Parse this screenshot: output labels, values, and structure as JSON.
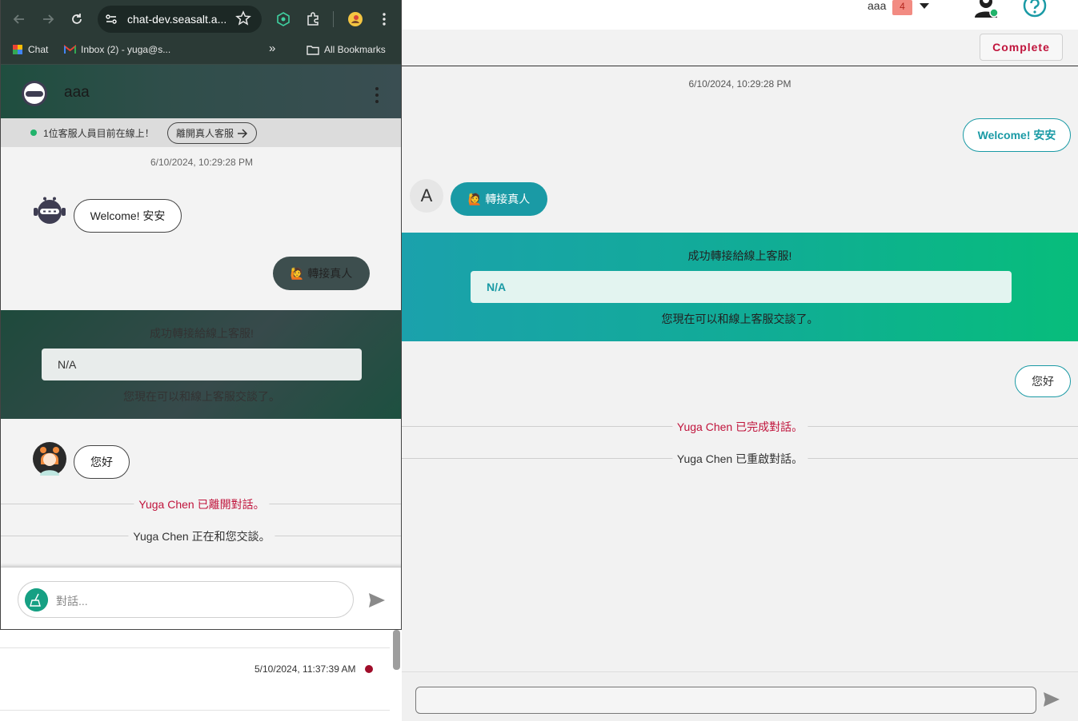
{
  "browser": {
    "url": "chat-dev.seasalt.a...",
    "bookmarks": [
      "Chat",
      "Inbox (2) - yuga@s..."
    ],
    "all_bookmarks": "All Bookmarks",
    "overflow": "»"
  },
  "widget": {
    "title": "aaa",
    "online_status": "1位客服人員目前在線上！",
    "leave_button": "離開真人客服",
    "timestamp": "6/10/2024, 10:29:28 PM",
    "welcome_message": "Welcome! 安安",
    "transfer_message": "轉接真人",
    "transfer_emoji": "🙋",
    "banner": {
      "title": "成功轉接給線上客服!",
      "box": "N/A",
      "subtitle": "您現在可以和線上客服交談了。"
    },
    "agent_message": "您好",
    "system_left": "Yuga Chen 已離開對話。",
    "system_talking": "Yuga Chen 正在和您交談。",
    "input_placeholder": "對話..."
  },
  "background_list": {
    "timestamp": "5/10/2024, 11:37:39 AM"
  },
  "console": {
    "user_name": "aaa",
    "count_badge": "4",
    "complete_button": "Complete",
    "timestamp": "6/10/2024, 10:29:28 PM",
    "welcome_message": "Welcome! 安安",
    "customer_initial": "A",
    "transfer_message": "轉接真人",
    "transfer_emoji": "🙋",
    "banner": {
      "title": "成功轉接給線上客服!",
      "box": "N/A",
      "subtitle": "您現在可以和線上客服交談了。"
    },
    "agent_message": "您好",
    "system_completed": "Yuga Chen 已完成對話。",
    "system_reopened": "Yuga Chen 已重啟對話。",
    "input_value": ""
  },
  "colors": {
    "brand_teal": "#1a9aa5",
    "brand_green": "#07bd7b",
    "alert_red": "#c0143c",
    "online_green": "#21b36b"
  }
}
